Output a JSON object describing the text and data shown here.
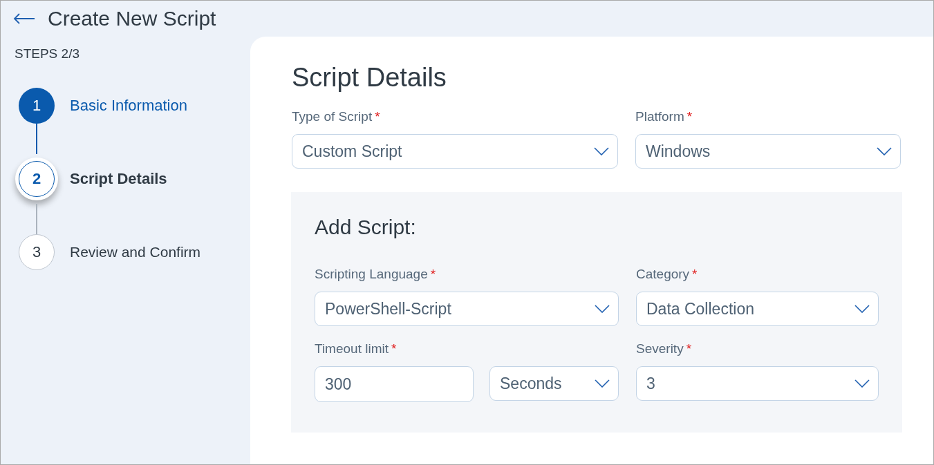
{
  "header": {
    "title": "Create New Script"
  },
  "steps": {
    "counter": "STEPS 2/3",
    "items": [
      {
        "number": "1",
        "label": "Basic Information",
        "kind": "done"
      },
      {
        "number": "2",
        "label": "Script Details",
        "kind": "current"
      },
      {
        "number": "3",
        "label": "Review and Confirm",
        "kind": "upcoming"
      }
    ]
  },
  "form": {
    "title": "Script Details",
    "fields": [
      {
        "label": "Type of Script",
        "required_mark": "*",
        "value": "Custom Script"
      },
      {
        "label": "Platform",
        "required_mark": "*",
        "value": "Windows"
      }
    ],
    "section": {
      "title": "Add Script:",
      "fields": [
        {
          "label": "Scripting Language",
          "required_mark": "*",
          "value": "PowerShell-Script"
        },
        {
          "label": "Category",
          "required_mark": "*",
          "value": "Data Collection"
        }
      ],
      "timeout": {
        "label": "Timeout limit",
        "required_mark": "*",
        "value": "300",
        "unit": "Seconds"
      },
      "severity": {
        "label": "Severity",
        "required_mark": "*",
        "value": "3"
      }
    }
  }
}
